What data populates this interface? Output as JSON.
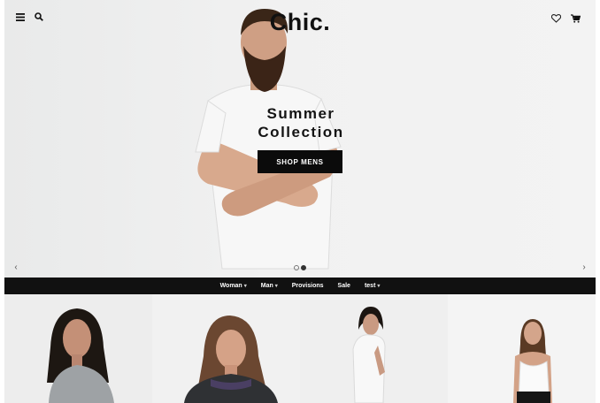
{
  "brand": {
    "logo": "Chic."
  },
  "hero": {
    "headline_line1": "Summer",
    "headline_line2": "Collection",
    "cta_label": "SHOP MENS",
    "slides": {
      "count": 2,
      "active_index": 1
    }
  },
  "nav": {
    "items": [
      {
        "label": "Woman",
        "caret": "▾"
      },
      {
        "label": "Man",
        "caret": "▾"
      },
      {
        "label": "Provisions",
        "caret": ""
      },
      {
        "label": "Sale",
        "caret": ""
      },
      {
        "label": "test",
        "caret": "▾"
      }
    ]
  },
  "icons": {
    "menu": "hamburger-icon",
    "search": "search-icon",
    "wishlist": "heart-icon",
    "cart": "cart-icon",
    "prev": "chevron-left-icon",
    "next": "chevron-right-icon"
  },
  "arrows": {
    "prev": "‹",
    "next": "›"
  },
  "colors": {
    "nav_background": "#111111",
    "cta_background": "#0b0b0b",
    "hero_background": "#efefef"
  },
  "products": [
    {
      "tile": "woman-grey-top"
    },
    {
      "tile": "woman-dark-top"
    },
    {
      "tile": "woman-white-top-side"
    },
    {
      "tile": "woman-white-tank"
    }
  ]
}
